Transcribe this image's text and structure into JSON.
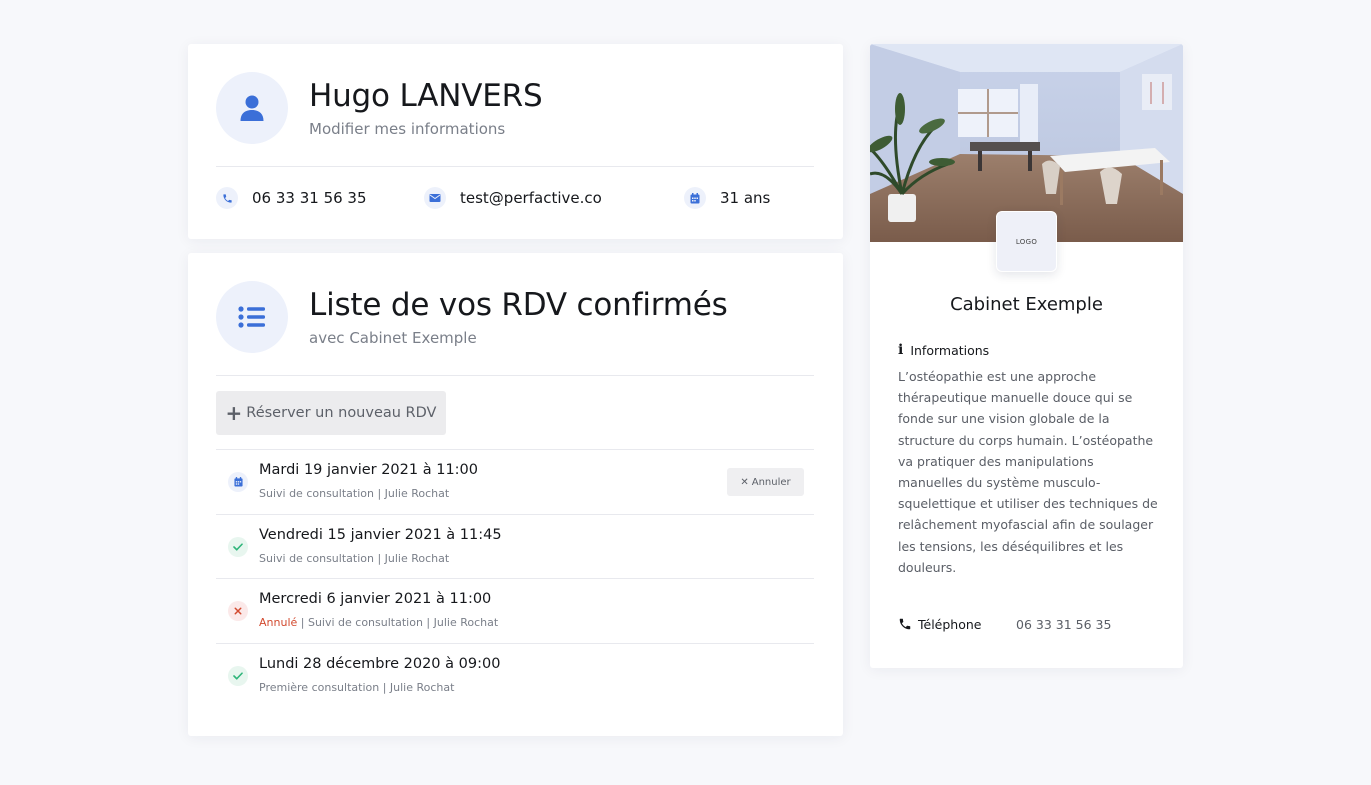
{
  "profile": {
    "name": "Hugo LANVERS",
    "edit_link": "Modifier mes informations",
    "phone": "06 33 31 56 35",
    "email": "test@perfactive.co",
    "age": "31 ans"
  },
  "appointments": {
    "title": "Liste de vos RDV confirmés",
    "subtitle": "avec Cabinet Exemple",
    "new_button": "Réserver un nouveau RDV",
    "cancel_button": "Annuler",
    "items": [
      {
        "date": "Mardi 19 janvier 2021 à 11:00",
        "status": "upcoming",
        "status_label": "",
        "meta": "Suivi de consultation | Julie Rochat"
      },
      {
        "date": "Vendredi 15 janvier 2021 à 11:45",
        "status": "done",
        "status_label": "",
        "meta": "Suivi de consultation | Julie Rochat"
      },
      {
        "date": "Mercredi 6 janvier 2021 à 11:00",
        "status": "cancelled",
        "status_label": "Annulé",
        "meta": " | Suivi de consultation | Julie Rochat"
      },
      {
        "date": "Lundi 28 décembre 2020 à 09:00",
        "status": "done",
        "status_label": "",
        "meta": "Première consultation | Julie Rochat"
      }
    ]
  },
  "cabinet": {
    "logo_text": "LOGO",
    "name": "Cabinet Exemple",
    "info_heading": "Informations",
    "description": "L’ostéopathie est une approche thérapeutique manuelle douce qui se fonde sur une vision globale de la structure du corps humain. L’ostéopathe va pratiquer des manipulations manuelles du système musculo-squelettique et utiliser des techniques de relâchement myofascial afin de soulager les tensions, les déséquilibres et les douleurs.",
    "phone_label": "Téléphone",
    "phone_value": "06 33 31 56 35"
  },
  "colors": {
    "accent_blue": "#3b6fd8",
    "success_green": "#2fb57a",
    "danger_red": "#d24a2f",
    "icon_bg": "#edf1fb"
  },
  "icons": {
    "avatar": "user-icon",
    "list": "list-icon",
    "phone": "phone-icon",
    "email": "envelope-icon",
    "age": "calendar-icon",
    "upcoming": "calendar-icon",
    "done": "check-icon",
    "cancelled": "cross-icon",
    "info": "info-icon"
  }
}
